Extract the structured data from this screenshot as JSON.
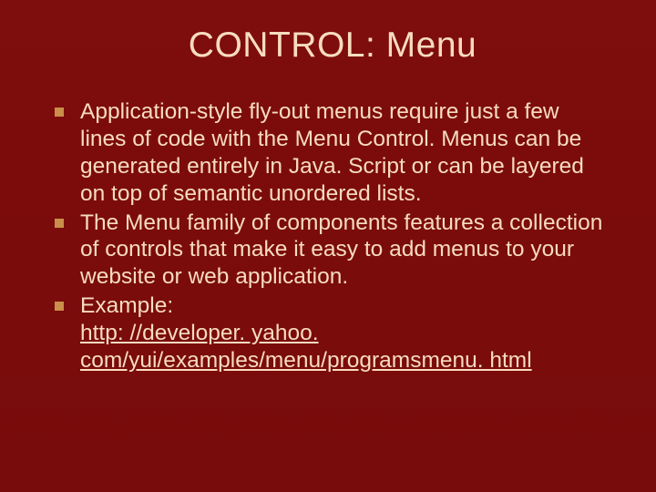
{
  "title": "CONTROL: Menu",
  "bullets": [
    {
      "text": "Application-style fly-out menus require just a few lines of code with the Menu Control. Menus can be generated entirely in Java. Script or can be layered on top of semantic unordered lists."
    },
    {
      "text": "The Menu family of components features a collection of controls that make it easy to add menus to your website or web application."
    },
    {
      "prefix": "Example: ",
      "link_text": "http: //developer. yahoo. com/yui/examples/menu/programsmenu. html"
    }
  ]
}
